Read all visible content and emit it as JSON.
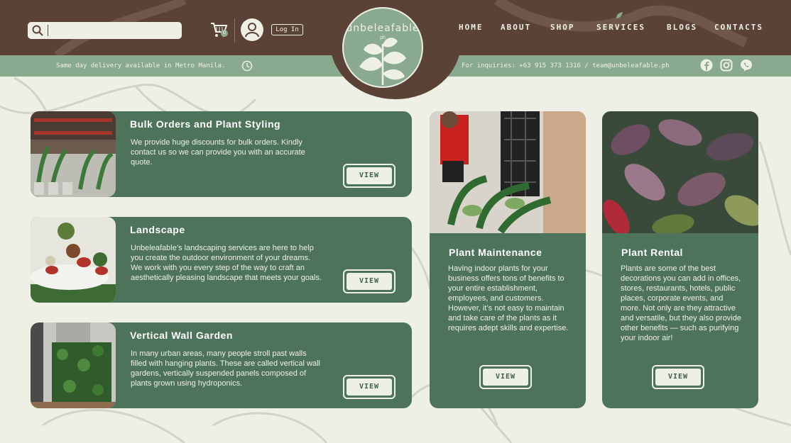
{
  "brand": {
    "name": "unbeleafable",
    "suffix": "ph"
  },
  "search": {
    "placeholder": ""
  },
  "cart": {
    "count": "0"
  },
  "header": {
    "login_label": "Log In"
  },
  "nav": [
    {
      "label": "HOME"
    },
    {
      "label": "ABOUT"
    },
    {
      "label": "SHOP"
    },
    {
      "label": "SERVICES"
    },
    {
      "label": "BLOGS"
    },
    {
      "label": "CONTACTS"
    }
  ],
  "subbar": {
    "delivery_text": "Same day delivery available in Metro Manila.",
    "inquiry_text": "For inquiries: +63 915 373 1316 / team@unbeleafable.ph"
  },
  "services": [
    {
      "title": "Bulk Orders and Plant Styling",
      "description": "We provide huge discounts for bulk orders. Kindly contact us so we can provide you with an accurate quote.",
      "button": "VIEW"
    },
    {
      "title": "Landscape",
      "description": "Unbeleafable’s landscaping services are here to help you create the outdoor environment of your dreams. We work with you every step of the way to craft an aesthetically pleasing landscape that meets your goals.",
      "button": "VIEW"
    },
    {
      "title": "Vertical Wall Garden",
      "description": "In many urban areas, many people stroll past walls filled with hanging plants. These are called vertical wall gardens, vertically suspended panels composed of plants grown using hydroponics.",
      "button": "VIEW"
    },
    {
      "title": "Plant Maintenance",
      "description": "Having indoor plants for your business offers tons of benefits to your entire establishment, employees, and customers. However, it’s not easy to maintain and take care of the plants as it requires adept skills and expertise.",
      "button": "VIEW"
    },
    {
      "title": "Plant Rental",
      "description": "Plants are some of the best decorations you can add in offices, stores, restaurants, hotels, public places, corporate events, and more. Not only are they attractive and versatile, but they also provide other benefits — such as purifying your indoor air!",
      "button": "VIEW"
    }
  ],
  "colors": {
    "header_brown": "#5b4236",
    "sage": "#8aaa8f",
    "card_green": "#4d735a",
    "background": "#eef0e6"
  },
  "icons": [
    "search-icon",
    "cart-icon",
    "user-icon",
    "clock-icon",
    "facebook-icon",
    "instagram-icon",
    "viber-icon"
  ]
}
